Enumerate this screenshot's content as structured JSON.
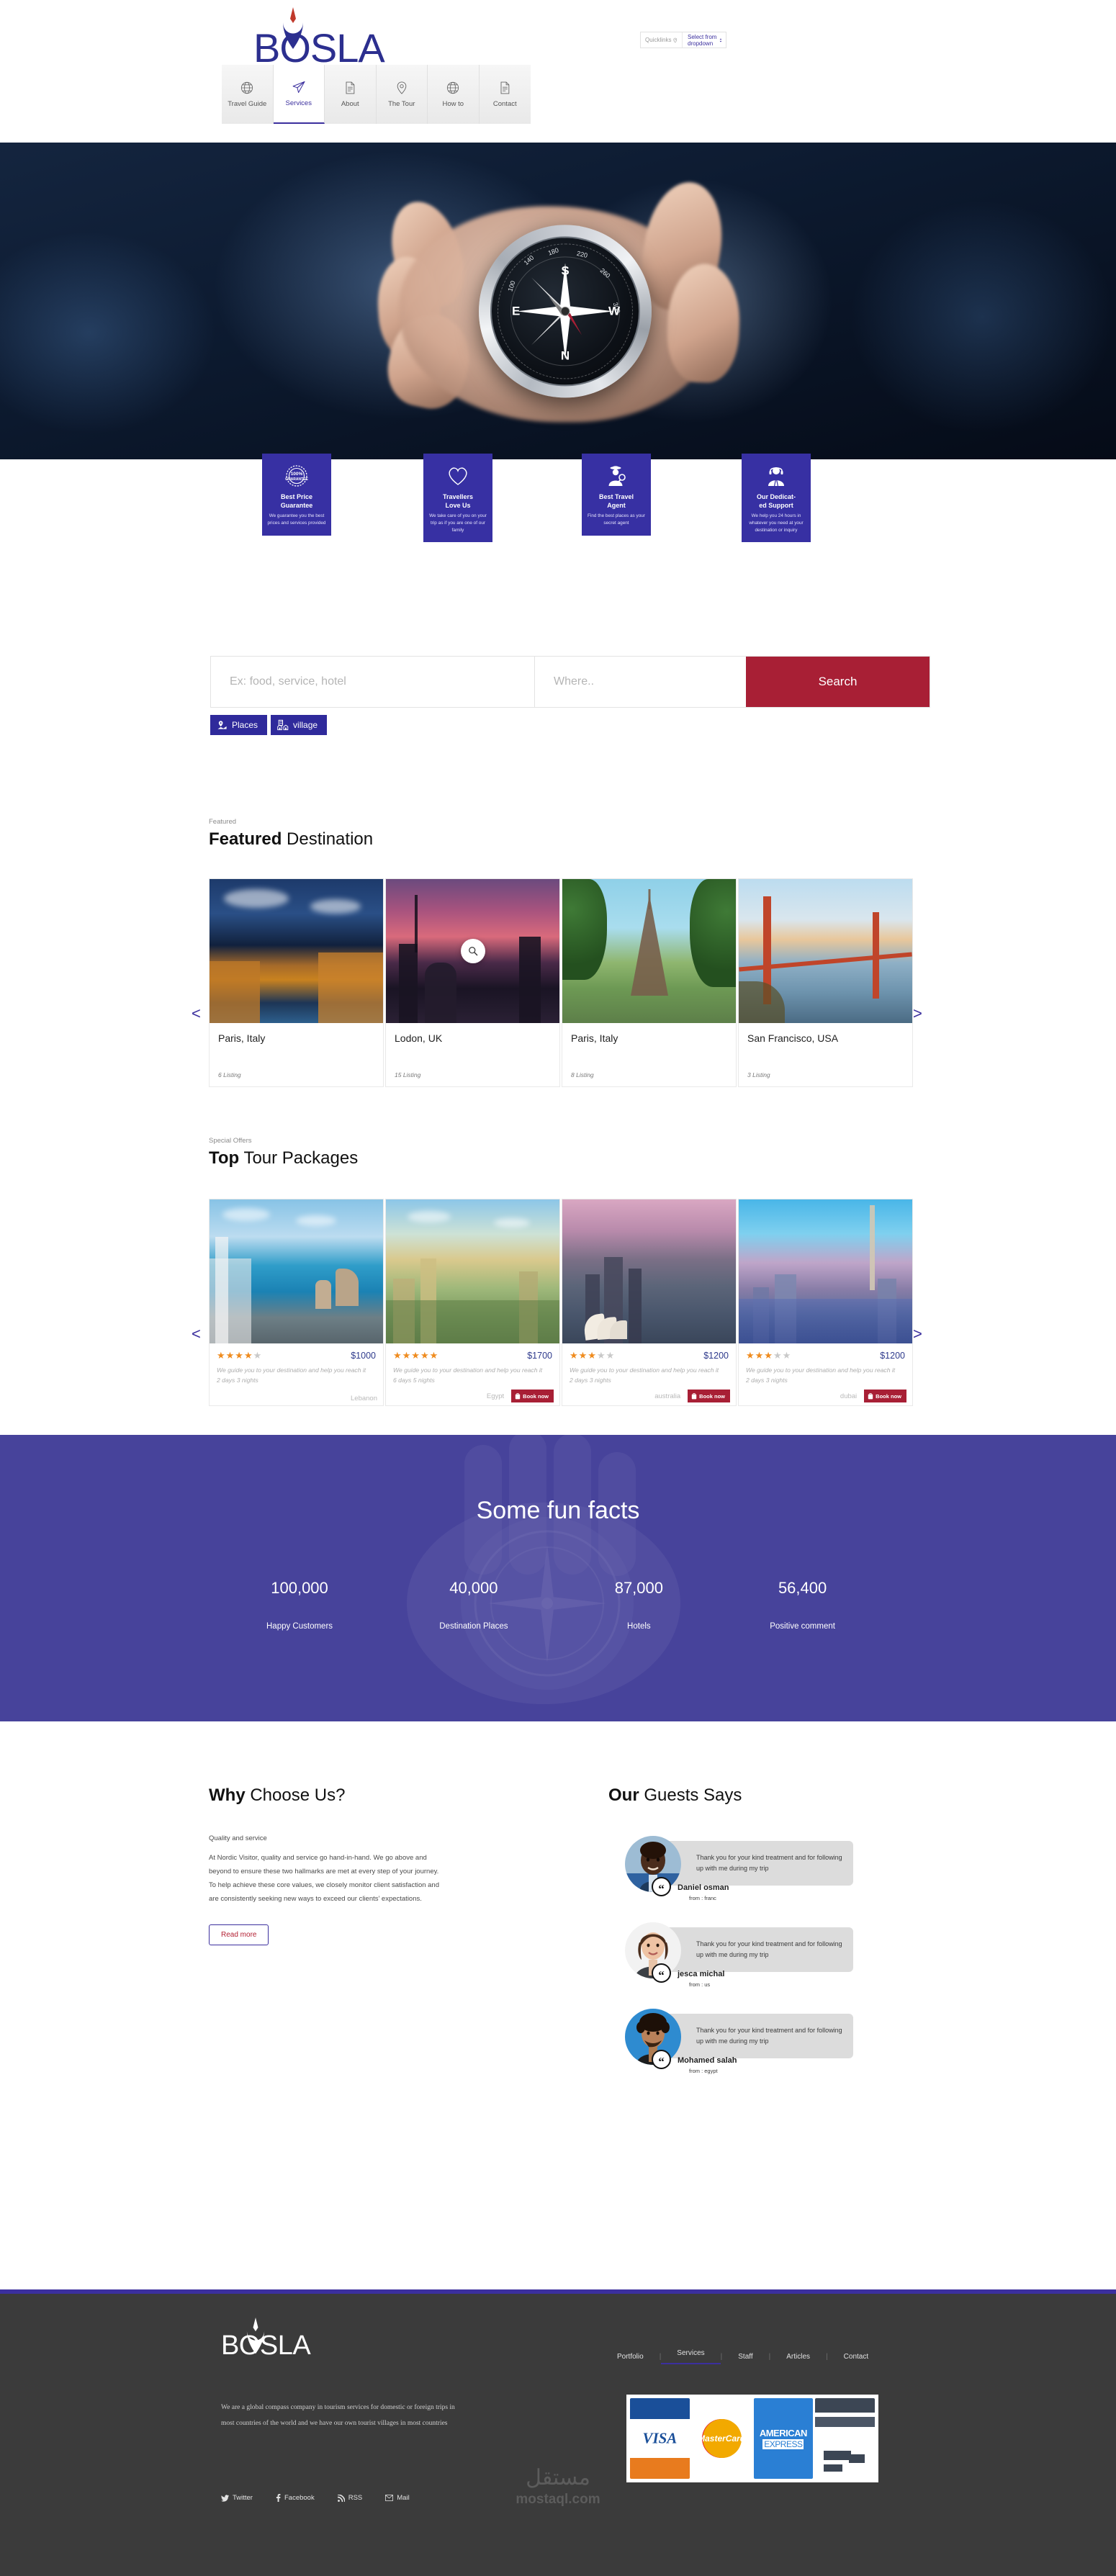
{
  "brand": {
    "name": "BOSLA",
    "primary": "#3b2f9e",
    "accent": "#a81f35",
    "facts_bg": "#47439b"
  },
  "header": {
    "quicklinks_label": "Quicklinks",
    "quicklinks_value": "Select from dropdown",
    "nav": [
      {
        "label": "Travel Guide",
        "icon": "globe-icon",
        "active": false
      },
      {
        "label": "Services",
        "icon": "paper-plane-icon",
        "active": true
      },
      {
        "label": "About",
        "icon": "document-icon",
        "active": false
      },
      {
        "label": "The Tour",
        "icon": "map-pin-icon",
        "active": false
      },
      {
        "label": "How to",
        "icon": "globe-icon",
        "active": false
      },
      {
        "label": "Contact",
        "icon": "document-icon",
        "active": false
      }
    ]
  },
  "features": [
    {
      "icon": "guarantee-badge-icon",
      "title": "Best Price\nGuarantee",
      "desc": "We guarantee you the best prices and services provided"
    },
    {
      "icon": "heart-icon",
      "title": "Travellers\nLove Us",
      "desc": "We take care of you on your trip as if you are one of our family"
    },
    {
      "icon": "detective-icon",
      "title": "Best Travel\nAgent",
      "desc": "Find the best places as your secret agent"
    },
    {
      "icon": "headset-support-icon",
      "title": "Our Dedicat-\ned Support",
      "desc": "We help you 24 hours in whatever you need at your destination or inquiry"
    }
  ],
  "search": {
    "what_placeholder": "Ex: food, service, hotel",
    "where_placeholder": "Where..",
    "button_label": "Search",
    "chips": [
      {
        "label": "Places",
        "icon": "map-location-icon"
      },
      {
        "label": "village",
        "icon": "village-buildings-icon"
      }
    ]
  },
  "destinations": {
    "eyebrow": "Featured",
    "title_bold": "Featured",
    "title_rest": " Destination",
    "prev": "<",
    "next": ">",
    "items": [
      {
        "name": "Paris, Italy",
        "listing": "6 Listing",
        "img": "img-venice"
      },
      {
        "name": "Lodon, UK",
        "listing": "15 Listing",
        "img": "img-london"
      },
      {
        "name": "Paris, Italy",
        "listing": "8 Listing",
        "img": "img-paris"
      },
      {
        "name": "San Francisco, USA",
        "listing": "3 Listing",
        "img": "img-sf"
      }
    ]
  },
  "tours": {
    "eyebrow": "Special Offers",
    "title_bold": "Top",
    "title_rest": " Tour Packages",
    "prev": "<",
    "next": ">",
    "book_label": "Book now",
    "items": [
      {
        "rating": 4,
        "price": "$1000",
        "desc": "We guide you to your destination and help you reach it",
        "nights": "2 days 3 nights",
        "country": "Lebanon",
        "img": "img-lebanon",
        "has_book": false
      },
      {
        "rating": 5,
        "price": "$1700",
        "desc": "We guide you to your destination and help you reach it",
        "nights": "6 days 5 nights",
        "country": "Egypt",
        "img": "img-egypt",
        "has_book": true
      },
      {
        "rating": 3,
        "price": "$1200",
        "desc": "We guide you to your destination and help you reach it",
        "nights": "2 days 3 nights",
        "country": "australia",
        "img": "img-aus",
        "has_book": true
      },
      {
        "rating": 3,
        "price": "$1200",
        "desc": "We guide you to your destination and help you reach it",
        "nights": "2 days 3 nights",
        "country": "dubai",
        "img": "img-dubai",
        "has_book": true
      }
    ]
  },
  "facts": {
    "title": "Some fun facts",
    "items": [
      {
        "number": "100,000",
        "label": "Happy Customers"
      },
      {
        "number": "40,000",
        "label": "Destination Places"
      },
      {
        "number": "87,000",
        "label": "Hotels"
      },
      {
        "number": "56,400",
        "label": "Positive comment"
      }
    ]
  },
  "why": {
    "title_bold": "Why",
    "title_rest": " Choose Us?",
    "subtitle": "Quality and service",
    "body": "At Nordic Visitor, quality and service go hand-in-hand. We go above and beyond to ensure these two hallmarks are met at every step of your journey. To help achieve these core values, we closely monitor client satisfaction and are consistently seeking new ways to exceed our clients’ expectations.",
    "read_more": "Read more"
  },
  "testimonials": {
    "title_bold": "Our",
    "title_rest": " Guests Says",
    "items": [
      {
        "quote": "Thank you for your kind treatment and for following up with me during my trip",
        "name": "Daniel osman",
        "from": "from : franc",
        "avatar": "avatar-daniel"
      },
      {
        "quote": "Thank you for your kind treatment and for following up with me during my trip",
        "name": "jesca michal",
        "from": "from : us",
        "avatar": "avatar-jesca"
      },
      {
        "quote": "Thank you for your kind treatment and for following up with me during my trip",
        "name": "Mohamed salah",
        "from": "from : egypt",
        "avatar": "avatar-mohamed"
      }
    ]
  },
  "footer": {
    "logo": "BOSLA",
    "about": "We are a global compass company in tourism services for domestic or foreign trips in most countries of the world and we have our own tourist villages in most countries",
    "social": [
      {
        "label": "Twitter",
        "icon": "twitter-icon"
      },
      {
        "label": "Facebook",
        "icon": "facebook-icon"
      },
      {
        "label": "RSS",
        "icon": "rss-icon"
      },
      {
        "label": "Mail",
        "icon": "mail-icon"
      }
    ],
    "nav": [
      {
        "label": "Portfolio",
        "active": false
      },
      {
        "label": "Services",
        "active": true
      },
      {
        "label": "Staff",
        "active": false
      },
      {
        "label": "Articles",
        "active": false
      },
      {
        "label": "Contact",
        "active": false
      }
    ],
    "payments": [
      "VISA",
      "MasterCard",
      "AMERICAN EXPRESS",
      "generic-card"
    ]
  },
  "watermark": {
    "arabic": "مستقل",
    "latin": "mostaql.com"
  }
}
